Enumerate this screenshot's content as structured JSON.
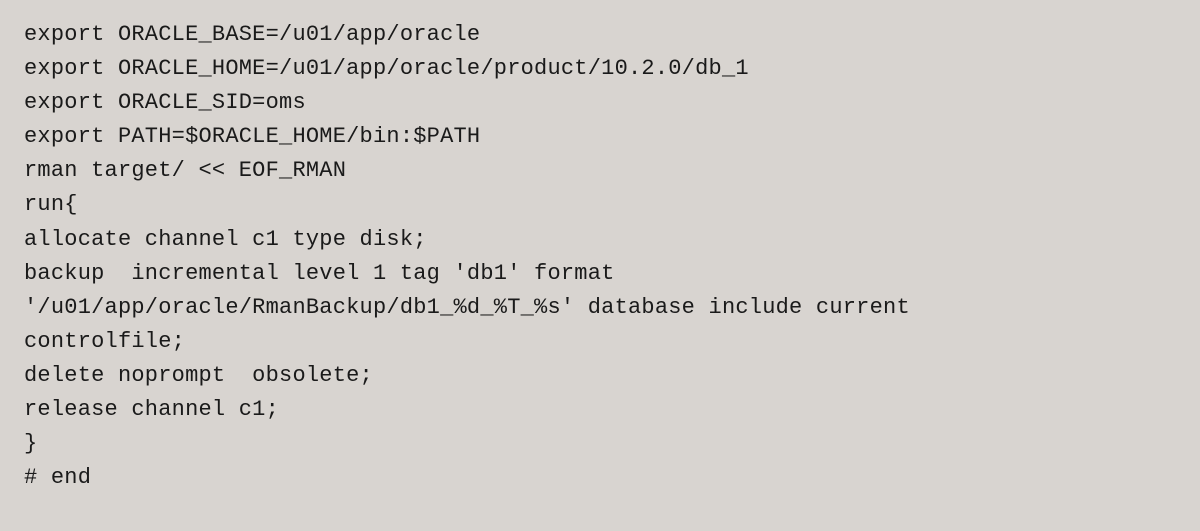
{
  "code": {
    "lines": [
      "export ORACLE_BASE=/u01/app/oracle",
      "export ORACLE_HOME=/u01/app/oracle/product/10.2.0/db_1",
      "export ORACLE_SID=oms",
      "export PATH=$ORACLE_HOME/bin:$PATH",
      "rman target/ << EOF_RMAN",
      "run{",
      "allocate channel c1 type disk;",
      "backup  incremental level 1 tag 'db1' format",
      "'/u01/app/oracle/RmanBackup/db1_%d_%T_%s' database include current",
      "controlfile;",
      "delete noprompt  obsolete;",
      "release channel c1;",
      "}",
      "# end"
    ]
  }
}
